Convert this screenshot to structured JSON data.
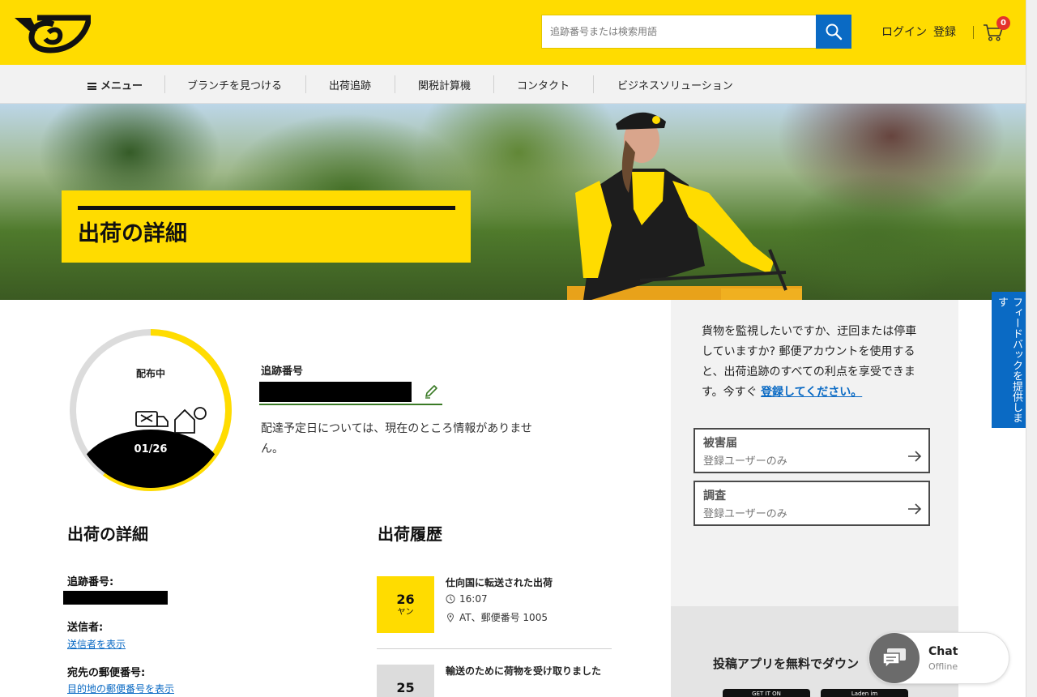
{
  "header": {
    "logo": "post-horn-logo",
    "search": {
      "placeholder": "追跡番号または検索用語",
      "value": ""
    },
    "login_label": "ログイン",
    "register_label": "登録",
    "cart_count": "0",
    "brand_color": "#FFDC00",
    "accent_color": "#0A6AC4"
  },
  "nav": {
    "menu_label": "メニュー",
    "items": [
      "ブランチを見つける",
      "出荷追跡",
      "関税計算機",
      "コンタクト",
      "ビジネスソリューション"
    ]
  },
  "hero": {
    "title": "出荷の詳細"
  },
  "feedback": {
    "label": "フィードバックを提供します"
  },
  "status": {
    "label": "配布中",
    "date": "01/26",
    "progress_fraction": 0.6
  },
  "tracking": {
    "label": "追跡番号",
    "number_redacted": true,
    "delivery_note": "配達予定日については、現在のところ情報がありません。"
  },
  "details": {
    "heading": "出荷の詳細",
    "tracking_label": "追跡番号:",
    "sender_label": "送信者:",
    "sender_link": "送信者を表示",
    "postcode_label": "宛先の郵便番号:",
    "postcode_link": "目的地の郵便番号を表示"
  },
  "history": {
    "heading": "出荷履歴",
    "events": [
      {
        "day": "26",
        "month": "ヤン",
        "title": "仕向国に転送された出荷",
        "time": "16:07",
        "location": "AT、郵便番号 1005",
        "highlight": true
      },
      {
        "day": "25",
        "month": "",
        "title": "輸送のために荷物を受け取りました",
        "time": "",
        "location": "",
        "highlight": false
      }
    ]
  },
  "sidebar": {
    "promo_text": "貨物を監視したいですか、迂回または停車していますか? 郵便アカウントを使用すると、出荷追跡のすべての利点を享受できます。今すぐ ",
    "promo_link": "登録してください。",
    "cards": [
      {
        "title": "被害届",
        "subtitle": "登録ユーザーのみ"
      },
      {
        "title": "調査",
        "subtitle": "登録ユーザーのみ"
      }
    ],
    "app_text": "投稿アプリを無料でダウン",
    "store_badges": [
      "GET IT ON",
      "Laden im"
    ]
  },
  "chat": {
    "title": "Chat",
    "status": "Offline"
  }
}
